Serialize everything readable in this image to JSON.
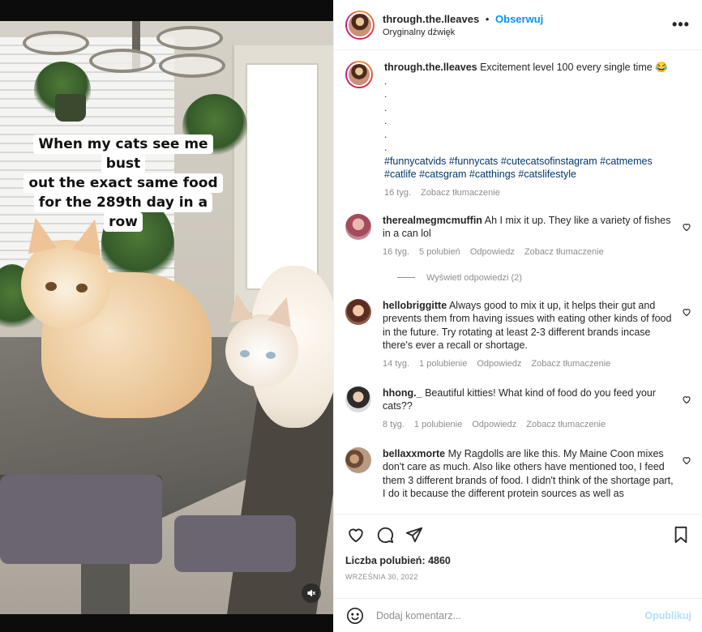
{
  "video": {
    "caption_lines": [
      "When my cats see me bust",
      "out the exact same food",
      "for the 289th day in a row"
    ],
    "mute_icon": "speaker-muted-icon"
  },
  "header": {
    "username": "through.the.lleaves",
    "separator": "•",
    "follow_label": "Obserwuj",
    "audio_label": "Oryginalny dźwięk",
    "more_icon": "more-options-icon",
    "more_label": "•••"
  },
  "post_caption": {
    "username": "through.the.lleaves",
    "text": "Excitement level 100 every single time 😂",
    "dot_lines": [
      ".",
      ".",
      ".",
      ".",
      ".",
      "."
    ],
    "hashtags_line1": "#funnycatvids #funnycats #cutecatsofinstagram #catmemes",
    "hashtags_line2": "#catlife #catsgram #catthings #catslifestyle",
    "age": "16 tyg.",
    "translate": "Zobacz tłumaczenie"
  },
  "comments": [
    {
      "username": "therealmegmcmuffin",
      "text": "Ah I mix it up. They like a variety of fishes in a can lol",
      "age": "16 tyg.",
      "likes": "5 polubień",
      "reply": "Odpowiedz",
      "translate": "Zobacz tłumaczenie",
      "view_replies": "Wyświetl odpowiedzi (2)"
    },
    {
      "username": "hellobriggitte",
      "text": "Always good to mix it up, it helps their gut and prevents them from having issues with eating other kinds of food in the future. Try rotating at least 2-3 different brands incase there's ever a recall or shortage.",
      "age": "14 tyg.",
      "likes": "1 polubienie",
      "reply": "Odpowiedz",
      "translate": "Zobacz tłumaczenie"
    },
    {
      "username": "hhong._",
      "text": "Beautiful kitties! What kind of food do you feed your cats??",
      "age": "8 tyg.",
      "likes": "1 polubienie",
      "reply": "Odpowiedz",
      "translate": "Zobacz tłumaczenie"
    },
    {
      "username": "bellaxxmorte",
      "text": "My Ragdolls are like this. My Maine Coon mixes don't care as much. Also like others have mentioned too, I feed them 3 different brands of food. I didn't think of the shortage part, I do it because the different protein sources as well as"
    }
  ],
  "actions": {
    "like_icon": "heart-icon",
    "comment_icon": "comment-icon",
    "share_icon": "share-icon",
    "save_icon": "bookmark-icon",
    "likes_text": "Liczba polubień: 4860",
    "date": "WRZEŚNIA 30, 2022"
  },
  "add_comment": {
    "emoji_icon": "emoji-icon",
    "placeholder": "Dodaj komentarz...",
    "publish_label": "Opublikuj"
  },
  "colors": {
    "link_blue": "#0095f6",
    "hashtag_blue": "#00376b",
    "muted_text": "#8e8e8e",
    "publish_disabled": "#b2dffc"
  }
}
